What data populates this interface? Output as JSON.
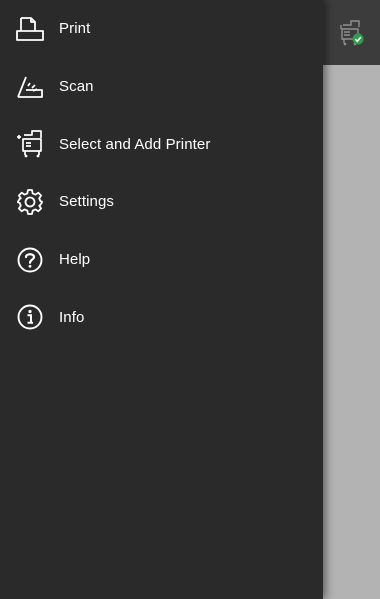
{
  "colors": {
    "drawer_background": "#2a2a2a",
    "appbar_background": "#3c3c3c",
    "content_background": "#b3b3b3",
    "text": "#ffffff",
    "status_ok": "#2e9e4a"
  },
  "appbar": {
    "printer_status_icon": "printer-connected-icon"
  },
  "menu": {
    "items": [
      {
        "label": "Print",
        "icon": "print-icon"
      },
      {
        "label": "Scan",
        "icon": "scan-icon"
      },
      {
        "label": "Select and Add Printer",
        "icon": "add-printer-icon"
      },
      {
        "label": "Settings",
        "icon": "gear-icon"
      },
      {
        "label": "Help",
        "icon": "help-icon"
      },
      {
        "label": "Info",
        "icon": "info-icon"
      }
    ]
  }
}
